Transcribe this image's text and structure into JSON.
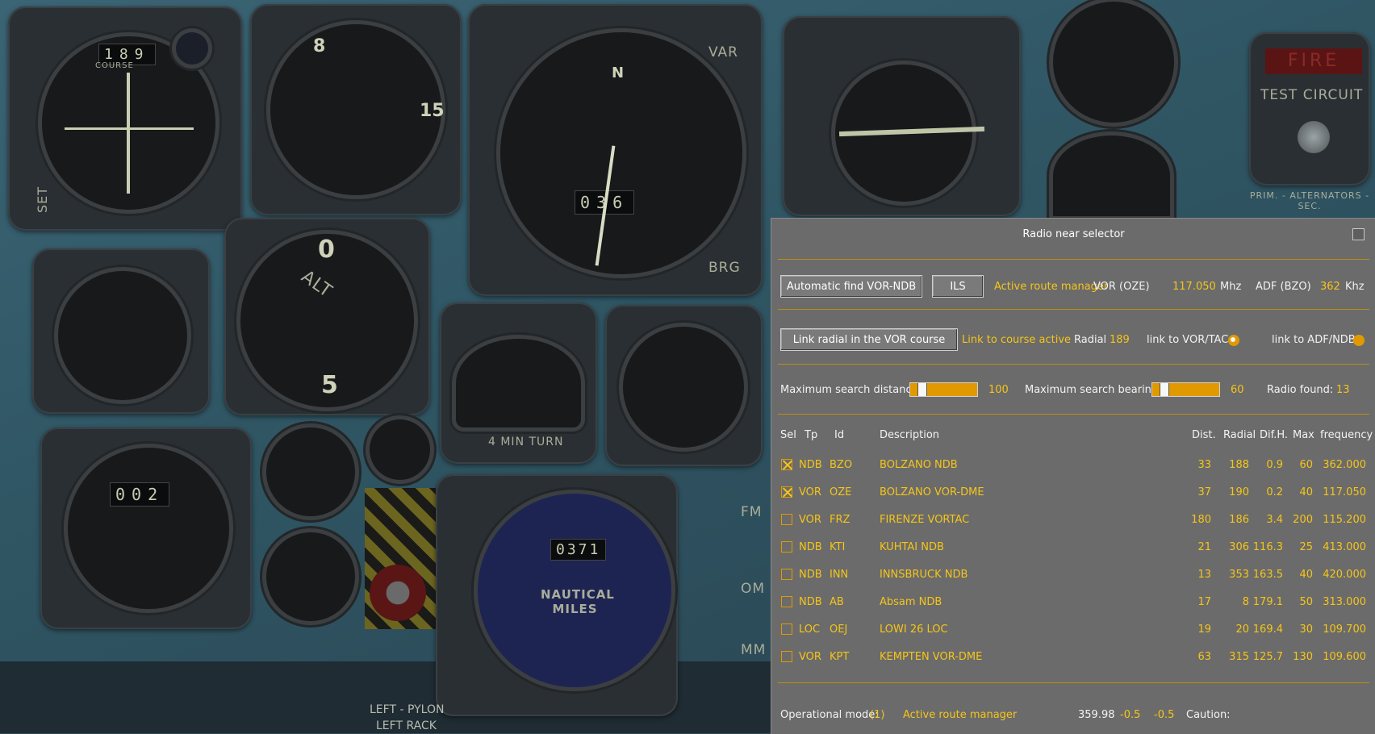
{
  "dialog": {
    "title": "Radio near selector",
    "auto_find_label": "Automatic find VOR-NDB",
    "ils_label": "ILS",
    "active_route_label": "Active route manager",
    "vor_label": "VOR (OZE)",
    "vor_freq": "117.050",
    "vor_unit": "Mhz",
    "adf_label": "ADF (BZO)",
    "adf_freq": "362",
    "adf_unit": "Khz",
    "link_radial_label": "Link radial in the VOR course",
    "link_course_status": "Link to course active",
    "radial_label": "Radial",
    "radial_value": "189",
    "link_vortac_label": "link to VOR/TAC",
    "link_vortac_on": true,
    "link_adf_label": "link to ADF/NDB",
    "link_adf_on": false,
    "max_distance_label": "Maximum search distance",
    "max_distance_value": "100",
    "max_distance_fraction": 0.12,
    "max_bearing_label": "Maximum search bearing",
    "max_bearing_value": "60",
    "max_bearing_fraction": 0.12,
    "radio_found_label": "Radio found:",
    "radio_found_value": "13",
    "columns": {
      "sel": "Sel",
      "tp": "Tp",
      "id": "Id",
      "description": "Description",
      "dist": "Dist.",
      "radial": "Radial",
      "difh": "Dif.H.",
      "max": "Max",
      "frequency": "frequency"
    },
    "rows": [
      {
        "selected": true,
        "tp": "NDB",
        "id": "BZO",
        "description": "BOLZANO NDB",
        "dist": "33",
        "radial": "188",
        "difh": "0.9",
        "max": "60",
        "frequency": "362.000"
      },
      {
        "selected": true,
        "tp": "VOR",
        "id": "OZE",
        "description": "BOLZANO VOR-DME",
        "dist": "37",
        "radial": "190",
        "difh": "0.2",
        "max": "40",
        "frequency": "117.050"
      },
      {
        "selected": false,
        "tp": "VOR",
        "id": "FRZ",
        "description": "FIRENZE VORTAC",
        "dist": "180",
        "radial": "186",
        "difh": "3.4",
        "max": "200",
        "frequency": "115.200"
      },
      {
        "selected": false,
        "tp": "NDB",
        "id": "KTI",
        "description": "KUHTAI NDB",
        "dist": "21",
        "radial": "306",
        "difh": "116.3",
        "max": "25",
        "frequency": "413.000"
      },
      {
        "selected": false,
        "tp": "NDB",
        "id": "INN",
        "description": "INNSBRUCK NDB",
        "dist": "13",
        "radial": "353",
        "difh": "163.5",
        "max": "40",
        "frequency": "420.000"
      },
      {
        "selected": false,
        "tp": "NDB",
        "id": "AB",
        "description": "Absam NDB",
        "dist": "17",
        "radial": "8",
        "difh": "179.1",
        "max": "50",
        "frequency": "313.000"
      },
      {
        "selected": false,
        "tp": "LOC",
        "id": "OEJ",
        "description": "LOWI 26 LOC",
        "dist": "19",
        "radial": "20",
        "difh": "169.4",
        "max": "30",
        "frequency": "109.700"
      },
      {
        "selected": false,
        "tp": "VOR",
        "id": "KPT",
        "description": "KEMPTEN VOR-DME",
        "dist": "63",
        "radial": "315",
        "difh": "125.7",
        "max": "130",
        "frequency": "109.600"
      }
    ],
    "footer": {
      "mode_label": "Operational mode:",
      "mode_value": "(1)",
      "mode_name": "Active route manager",
      "heading": "359.98",
      "val1": "-0.5",
      "val2": "-0.5",
      "caution_label": "Caution:"
    }
  },
  "cockpit": {
    "course_window": "189",
    "course_label": "COURSE",
    "phi_window": "036",
    "dist_window": "002",
    "nm_window": "0371",
    "turn_label": "4 MIN TURN",
    "nautical_label": "NAUTICAL MILES",
    "fire_label": "FIRE",
    "test_circuit_label": "TEST CIRCUIT",
    "alternators_label": "PRIM. - ALTERNATORS - SEC.",
    "left_pylon_label": "LEFT - PYLON",
    "left_rack_label": "LEFT RACK",
    "alt_label": "ALT",
    "brg_label": "BRG",
    "var_label": "VAR",
    "set_label": "SET",
    "fm_label": "FM",
    "om_label": "OM",
    "mm_label": "MM"
  }
}
